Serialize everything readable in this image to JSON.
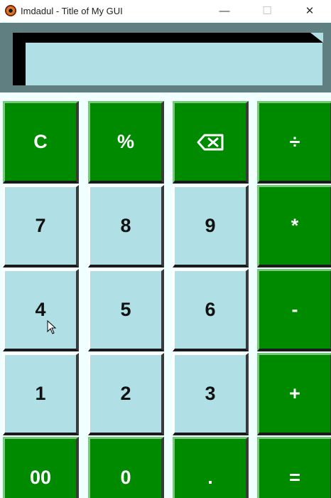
{
  "window": {
    "title": "Imdadul - Title of My GUI",
    "icon": "app-logo-icon",
    "controls": {
      "minimize": "—",
      "maximize": "☐",
      "close": "✕"
    }
  },
  "display": {
    "value": ""
  },
  "keypad": {
    "rows": [
      [
        {
          "label": "C",
          "style": "green",
          "name": "clear-button"
        },
        {
          "label": "%",
          "style": "green",
          "name": "percent-button"
        },
        {
          "label": "",
          "style": "green",
          "name": "backspace-button",
          "icon": "backspace-icon"
        },
        {
          "label": "÷",
          "style": "green",
          "name": "divide-button"
        }
      ],
      [
        {
          "label": "7",
          "style": "light",
          "name": "digit-7-button"
        },
        {
          "label": "8",
          "style": "light",
          "name": "digit-8-button"
        },
        {
          "label": "9",
          "style": "light",
          "name": "digit-9-button"
        },
        {
          "label": "*",
          "style": "green",
          "name": "multiply-button"
        }
      ],
      [
        {
          "label": "4",
          "style": "light",
          "name": "digit-4-button"
        },
        {
          "label": "5",
          "style": "light",
          "name": "digit-5-button"
        },
        {
          "label": "6",
          "style": "light",
          "name": "digit-6-button"
        },
        {
          "label": "-",
          "style": "green",
          "name": "subtract-button"
        }
      ],
      [
        {
          "label": "1",
          "style": "light",
          "name": "digit-1-button"
        },
        {
          "label": "2",
          "style": "light",
          "name": "digit-2-button"
        },
        {
          "label": "3",
          "style": "light",
          "name": "digit-3-button"
        },
        {
          "label": "+",
          "style": "green",
          "name": "add-button"
        }
      ],
      [
        {
          "label": "00",
          "style": "green",
          "name": "double-zero-button"
        },
        {
          "label": "0",
          "style": "green",
          "name": "digit-0-button"
        },
        {
          "label": ".",
          "style": "green",
          "name": "decimal-button"
        },
        {
          "label": "=",
          "style": "green",
          "name": "equals-button"
        }
      ]
    ]
  },
  "colors": {
    "green_key": "#008a00",
    "light_key": "#b0e0e6",
    "background": "#f0ffff",
    "display_frame": "#5f7f80"
  }
}
